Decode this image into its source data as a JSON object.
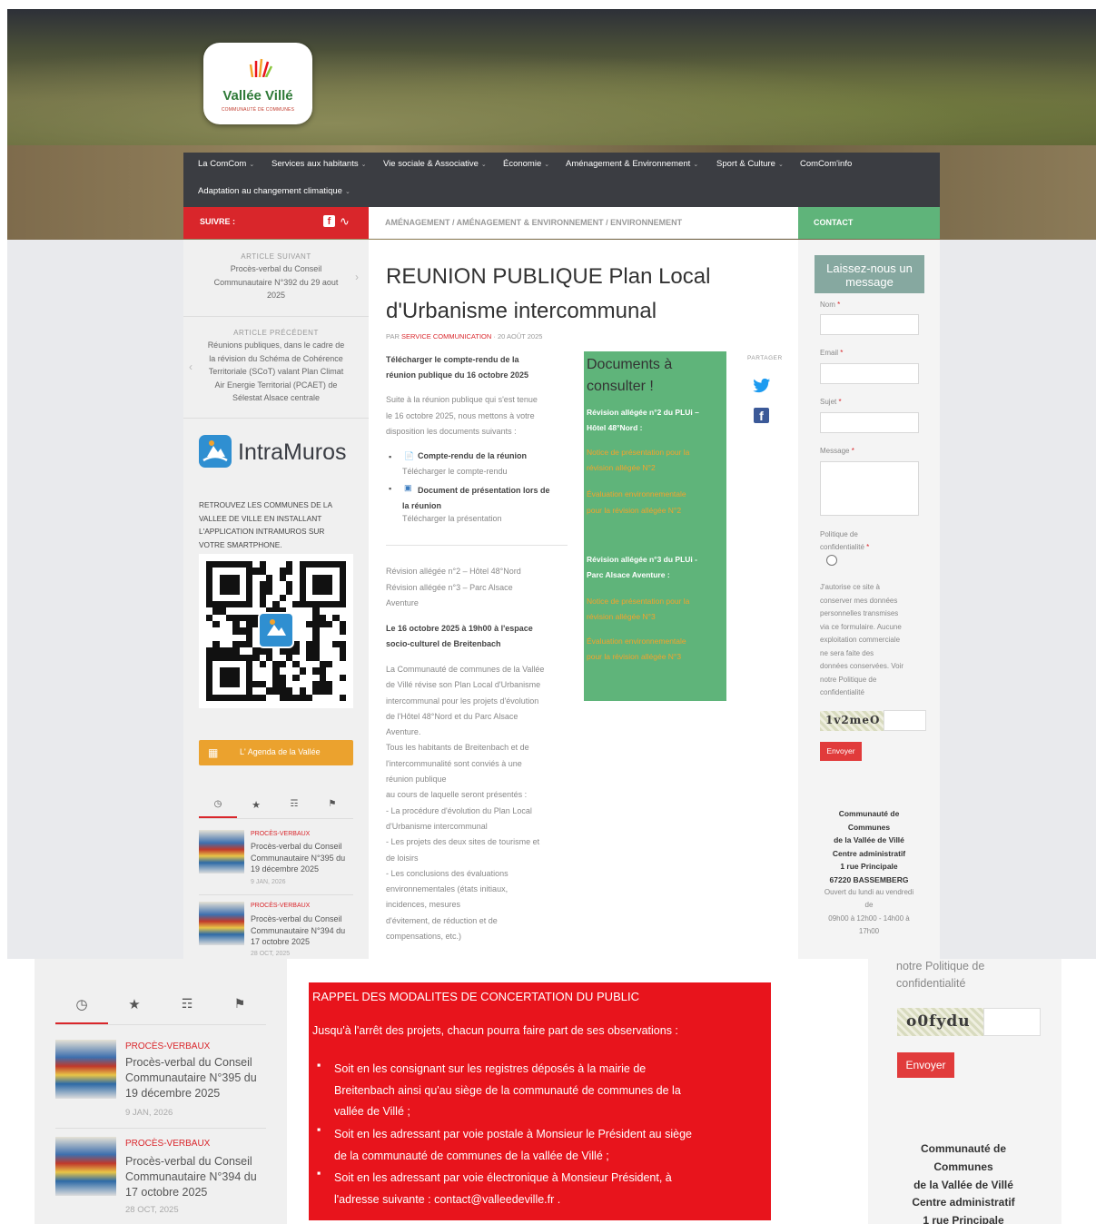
{
  "logo": {
    "brand": "Vallée Villé",
    "subtitle": "COMMUNAUTÉ DE COMMUNES"
  },
  "nav": {
    "items": [
      "La ComCom",
      "Services aux habitants",
      "Vie sociale & Associative",
      "Économie",
      "Aménagement & Environnement",
      "Sport & Culture",
      "ComCom'info",
      "Adaptation au changement climatique"
    ],
    "caret": "⌄"
  },
  "bar": {
    "suivre": "SUIVRE :",
    "crumb": "AMÉNAGEMENT / AMÉNAGEMENT & ENVIRONNEMENT / ENVIRONNEMENT",
    "contact": "CONTACT"
  },
  "left": {
    "next_label": "ARTICLE SUIVANT",
    "next_lines": [
      "Procès-verbal du Conseil",
      "Communautaire N°392 du 29 aout",
      "2025"
    ],
    "prev_label": "ARTICLE PRÉCÉDENT",
    "prev_lines": [
      "Réunions publiques, dans le cadre de",
      "la révision du Schéma de Cohérence",
      "Territoriale (SCoT) valant Plan Climat",
      "Air Energie Territorial (PCAET) de",
      "Sélestat Alsace centrale"
    ],
    "intramuros": "IntraMuros",
    "promo": [
      "RETROUVEZ LES COMMUNES DE LA",
      "VALLEE DE VILLE EN INSTALLANT",
      "L'APPLICATION INTRAMUROS SUR",
      "VOTRE SMARTPHONE."
    ],
    "agenda": "L' Agenda de la Vallée",
    "posts": [
      {
        "cat": "PROCÈS-VERBAUX",
        "lines": [
          "Procès-verbal du Conseil",
          "Communautaire N°395 du",
          "19 décembre 2025"
        ],
        "date": "9 JAN, 2026"
      },
      {
        "cat": "PROCÈS-VERBAUX",
        "lines": [
          "Procès-verbal du Conseil",
          "Communautaire N°394 du",
          "17 octobre 2025"
        ],
        "date": "28 OCT, 2025"
      }
    ]
  },
  "article": {
    "title1": "REUNION PUBLIQUE Plan Local",
    "title2": "d'Urbanisme intercommunal",
    "by": "PAR",
    "author": "SERVICE COMMUNICATION",
    "date": "· 20 AOÛT 2025",
    "intro": [
      "Télécharger le compte-rendu de la",
      "réunion publique du 16 octobre 2025"
    ],
    "p1": [
      "Suite à la réunion publique qui s'est tenue",
      "le 16 octobre 2025, nous mettons à votre",
      "disposition les documents suivants :"
    ],
    "li1": "Compte-rendu de la réunion",
    "li1sub": "Télécharger le compte-rendu",
    "li2a": "Document de présentation lors de",
    "li2b": "la réunion",
    "li2sub": "Télécharger la présentation",
    "rev": [
      "Révision allégée n°2 – Hôtel 48°Nord",
      "Révision allégée n°3 – Parc Alsace",
      "Aventure"
    ],
    "when": [
      "Le 16 octobre 2025 à 19h00 à l'espace",
      "socio-culturel de Breitenbach"
    ],
    "body": [
      "La Communauté de communes de la Vallée",
      "de Villé révise son Plan Local d'Urbanisme",
      "intercommunal pour les projets d'évolution",
      "de l'Hôtel 48°Nord et du Parc Alsace",
      "Aventure.",
      "Tous les habitants de Breitenbach et de",
      "l'intercommunalité sont conviés à une",
      "réunion publique",
      "au cours de laquelle seront présentés :",
      "- La procédure d'évolution du Plan Local",
      "d'Urbanisme intercommunal",
      "- Les projets des deux sites de tourisme et",
      "de loisirs",
      "- Les conclusions des évaluations",
      "environnementales (états initiaux,",
      "incidences, mesures",
      "d'évitement, de réduction et de",
      "compensations, etc.)"
    ],
    "share": "PARTAGER"
  },
  "docs": {
    "title": [
      "Documents à",
      "consulter !"
    ],
    "h1": [
      "Révision allégée n°2 du PLUi –",
      "Hôtel 48°Nord :"
    ],
    "l1": [
      "Notice de présentation pour la",
      "révision allégée N°2"
    ],
    "l2": [
      "Évaluation environnementale",
      "pour la révision allégée N°2"
    ],
    "h2": [
      "Révision allégée n°3 du PLUi -",
      "Parc Alsace Aventure :"
    ],
    "l3": [
      "Notice de présentation pour la",
      "révision allégée N°3"
    ],
    "l4": [
      "Évaluation environnementale",
      "pour la révision allégée N°3"
    ]
  },
  "form": {
    "title": [
      "Laissez-nous un",
      "message"
    ],
    "nom": "Nom",
    "email": "Email",
    "sujet": "Sujet",
    "message": "Message",
    "req": "*",
    "politique": [
      "Politique de",
      "confidentialité"
    ],
    "consent": [
      "J'autorise ce site à",
      "conserver mes données",
      "personnelles transmises",
      "via ce formulaire. Aucune",
      "exploitation commerciale",
      "ne sera faite des",
      "données conservées. Voir",
      "notre Politique de",
      "confidentialité"
    ],
    "captcha": "1v2meO",
    "send": "Envoyer",
    "addr": [
      "Communauté de",
      "Communes",
      "de la Vallée de Villé",
      "Centre administratif",
      "1 rue Principale",
      "67220 BASSEMBERG"
    ],
    "hours": [
      "Ouvert du lundi au vendredi",
      "de",
      "09h00 à 12h00 - 14h00 à",
      "17h00"
    ]
  },
  "bottom": {
    "posts": [
      {
        "cat": "PROCÈS-VERBAUX",
        "lines": [
          "Procès-verbal du Conseil",
          "Communautaire N°395 du",
          "19 décembre 2025"
        ],
        "date": "9 JAN, 2026"
      },
      {
        "cat": "PROCÈS-VERBAUX",
        "lines": [
          "Procès-verbal du Conseil",
          "Communautaire N°394 du",
          "17 octobre 2025"
        ],
        "date": "28 OCT, 2025"
      }
    ],
    "rappel_title": "RAPPEL DES MODALITES DE CONCERTATION DU PUBLIC",
    "rappel_intro": "Jusqu'à l'arrêt des projets, chacun pourra faire part de ses observations :",
    "rappel_items": [
      [
        "Soit en les consignant sur les registres déposés à la mairie de",
        "Breitenbach ainsi qu'au siège de la communauté de communes de la",
        "vallée de Villé ;"
      ],
      [
        "Soit en les adressant par voie postale à Monsieur le Président au siège",
        "de la communauté de communes de la vallée de Villé ;"
      ],
      [
        "Soit en les adressant par voie électronique à Monsieur Président, à",
        "l'adresse suivante : contact@valleedeville.fr ."
      ]
    ],
    "politique": [
      "notre Politique de",
      "confidentialité"
    ],
    "captcha": "o0fydu",
    "send": "Envoyer",
    "addr": [
      "Communauté de",
      "Communes",
      "de la Vallée de Villé",
      "Centre administratif",
      "1 rue Principale"
    ]
  },
  "colors": {
    "red": "#d9262b",
    "green": "#5fb47a",
    "navbar": "#3b3d42",
    "orange": "#f5a32b",
    "alert": "#e8141c"
  }
}
